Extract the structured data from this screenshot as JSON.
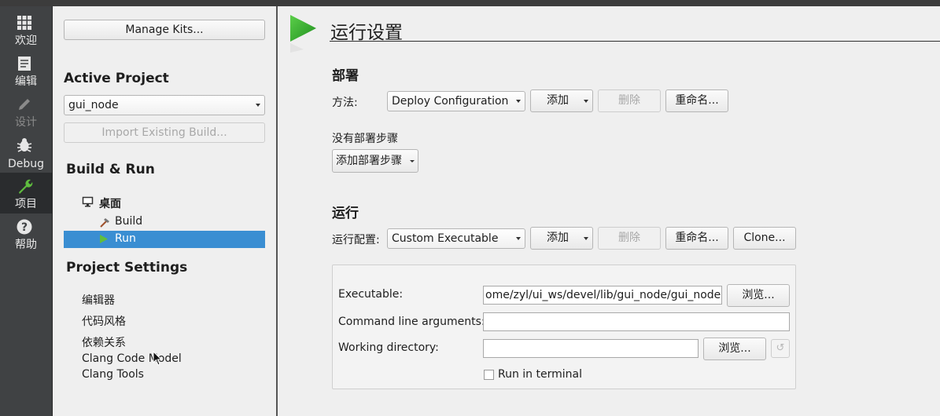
{
  "modes": [
    {
      "label": "欢迎",
      "icon": "grid-icon"
    },
    {
      "label": "编辑",
      "icon": "document-icon"
    },
    {
      "label": "设计",
      "icon": "pencil-icon"
    },
    {
      "label": "Debug",
      "icon": "bug-icon"
    },
    {
      "label": "项目",
      "icon": "wrench-icon"
    },
    {
      "label": "帮助",
      "icon": "help-icon"
    }
  ],
  "left": {
    "manage_kits": "Manage Kits...",
    "active_project_heading": "Active Project",
    "project_selected": "gui_node",
    "import_build": "Import Existing Build...",
    "build_run_heading": "Build & Run",
    "kit_name": "桌面",
    "build_label": "Build",
    "run_label": "Run",
    "project_settings_heading": "Project Settings",
    "settings_items": [
      "编辑器",
      "代码风格",
      "依赖关系",
      "Clang Code Model",
      "Clang Tools"
    ]
  },
  "main": {
    "title": "运行设置",
    "deploy": {
      "heading": "部署",
      "method_label": "方法:",
      "config_value": "Deploy Configuration",
      "add": "添加",
      "remove": "删除",
      "rename": "重命名...",
      "no_steps": "没有部署步骤",
      "add_step": "添加部署步骤"
    },
    "run": {
      "heading": "运行",
      "config_label": "运行配置:",
      "config_value": "Custom Executable",
      "add": "添加",
      "remove": "删除",
      "rename": "重命名...",
      "clone": "Clone...",
      "executable_label": "Executable:",
      "executable_value": "ome/zyl/ui_ws/devel/lib/gui_node/gui_node",
      "browse": "浏览...",
      "args_label": "Command line arguments:",
      "args_value": "",
      "workdir_label": "Working directory:",
      "workdir_value": "",
      "browse2": "浏览...",
      "run_in_terminal": "Run in terminal"
    }
  },
  "colors": {
    "selection": "#3a8ed2",
    "modebar": "#404244",
    "play_green": "#2ea62e"
  }
}
